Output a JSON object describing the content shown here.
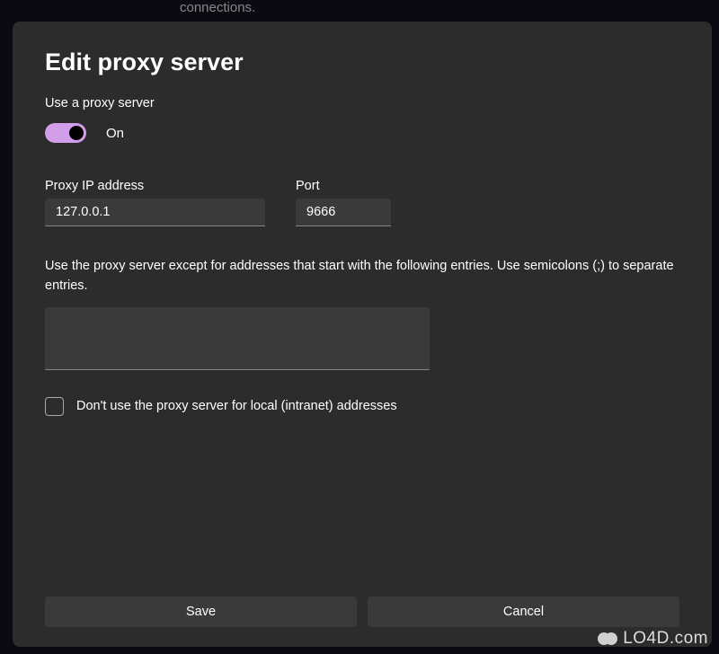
{
  "background": {
    "text": "connections."
  },
  "dialog": {
    "title": "Edit proxy server",
    "use_proxy_label": "Use a proxy server",
    "toggle_state": "On",
    "ip_label": "Proxy IP address",
    "ip_value": "127.0.0.1",
    "port_label": "Port",
    "port_value": "9666",
    "exceptions_description": "Use the proxy server except for addresses that start with the following entries. Use semicolons (;) to separate entries.",
    "exceptions_value": "",
    "local_checkbox_label": "Don't use the proxy server for local (intranet) addresses",
    "local_checkbox_checked": false,
    "save_label": "Save",
    "cancel_label": "Cancel"
  },
  "watermark": {
    "text": "LO4D.com"
  }
}
